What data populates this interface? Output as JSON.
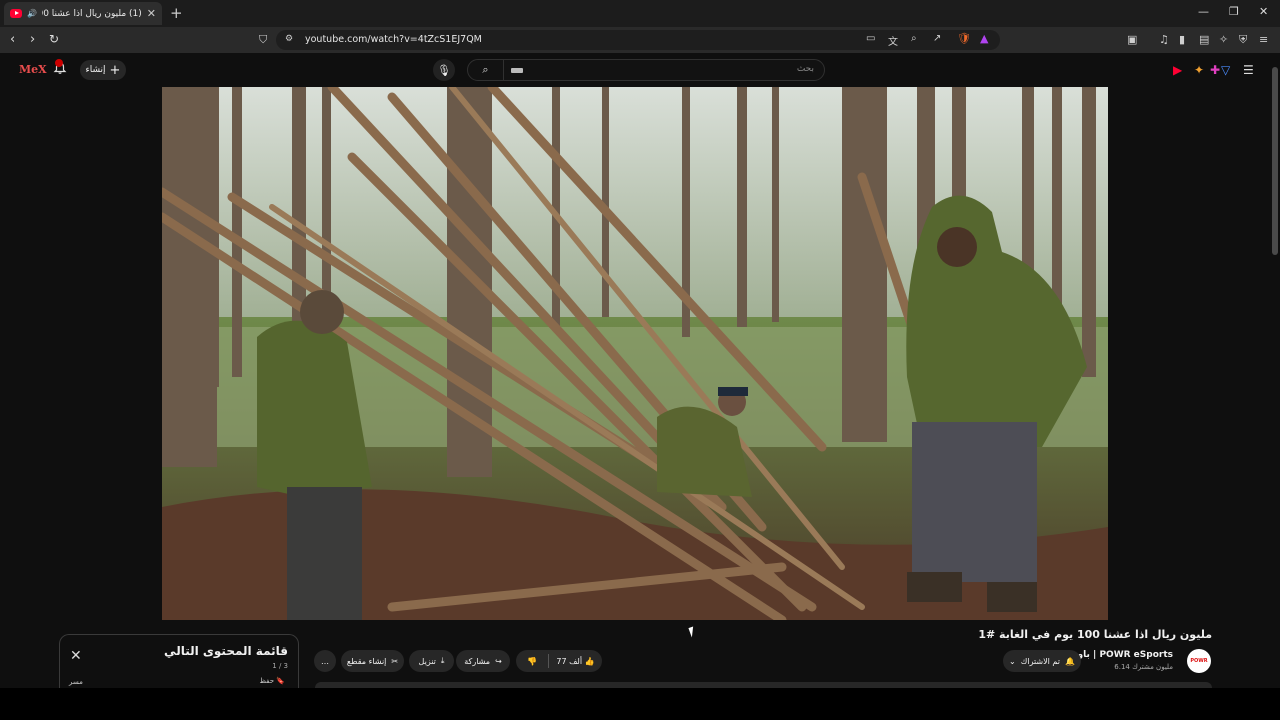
{
  "browser": {
    "tab_title": "(1) مليون ريال اذا عشنا 100 يو…",
    "url": "youtube.com/watch?v=4tZcS1EJ7QM",
    "new_tab": "+",
    "min": "—",
    "restore": "❐",
    "close": "✕"
  },
  "youtube": {
    "logo": "MeX",
    "create_label": "إنشاء",
    "search_placeholder": "بحث"
  },
  "video": {
    "title": "مليون ريال اذا عشنا 100 يوم في الغابة #1"
  },
  "channel": {
    "avatar_text": "POWR",
    "name": "باور | POWR eSports",
    "subs": "6.14 مليون مشترك",
    "subscribed_label": "تم الاشتراك"
  },
  "actions": {
    "likes": "77 ألف",
    "share": "مشاركة",
    "download": "تنزيل",
    "clip": "إنشاء مقطع",
    "more": "…"
  },
  "playlist": {
    "title": "قائمة المحتوى التالي",
    "count": "1 / 3",
    "save": "حفظ",
    "next_label": "مسر"
  },
  "colors": {
    "youtube_red": "#ff0033",
    "background": "#0f0f0f",
    "pill": "#272727"
  }
}
